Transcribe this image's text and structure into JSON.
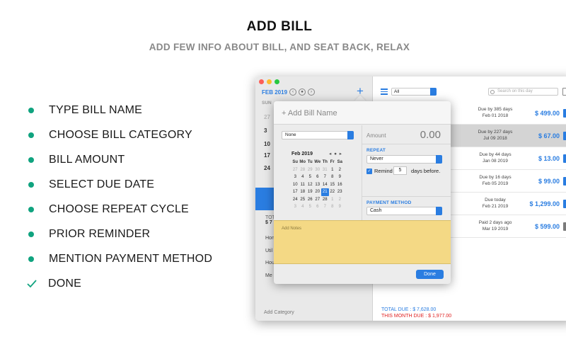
{
  "hero": {
    "title": "ADD BILL",
    "subtitle": "ADD FEW INFO ABOUT BILL, AND SEAT BACK, RELAX"
  },
  "features": [
    {
      "label": "TYPE BILL NAME",
      "marker": "dot"
    },
    {
      "label": "CHOOSE BILL CATEGORY",
      "marker": "dot"
    },
    {
      "label": "BILL AMOUNT",
      "marker": "dot"
    },
    {
      "label": "SELECT DUE DATE",
      "marker": "dot"
    },
    {
      "label": "CHOOSE REPEAT CYCLE",
      "marker": "dot"
    },
    {
      "label": "PRIOR REMINDER",
      "marker": "dot"
    },
    {
      "label": "MENTION PAYMENT METHOD",
      "marker": "dot"
    },
    {
      "label": "DONE",
      "marker": "check"
    }
  ],
  "colors": {
    "accent": "#10a37f",
    "blue": "#2a7de1",
    "notes": "#f4d985",
    "red": "#e02020"
  },
  "sidebar": {
    "month": "FEB 2019",
    "week_label": "SUN",
    "dates": [
      "27",
      "3",
      "10",
      "17",
      "24"
    ],
    "total_label": "TOT",
    "total_amount": "$ 7",
    "categories": [
      "Hon",
      "Util",
      "Hou",
      "Me"
    ],
    "add_category": "Add Category"
  },
  "main": {
    "filter": "All",
    "search_placeholder": "Search on this day",
    "bills": [
      {
        "due_line1": "Due by 385 days",
        "due_line2": "Feb 01 2018",
        "amount": "$ 499.00",
        "selected": false,
        "paid": false
      },
      {
        "due_line1": "Due by 227 days",
        "due_line2": "Jul 09 2018",
        "amount": "$ 67.00",
        "selected": true,
        "paid": false
      },
      {
        "due_line1": "Due by 44 days",
        "due_line2": "Jan 08 2019",
        "amount": "$ 13.00",
        "selected": false,
        "paid": false
      },
      {
        "due_line1": "Due by 16 days",
        "due_line2": "Feb 05 2019",
        "amount": "$ 99.00",
        "selected": false,
        "paid": false
      },
      {
        "due_line1": "Due today",
        "due_line2": "Feb 21 2019",
        "amount": "$ 1,299.00",
        "selected": false,
        "paid": false
      },
      {
        "due_line1": "Paid 2 days ago",
        "due_line2": "Mar 19 2019",
        "amount": "$ 599.00",
        "selected": false,
        "paid": true
      }
    ],
    "total_due": "TOTAL DUE : $ 7,628.00",
    "month_due": "THIS MONTH DUE : $ 1,977.00"
  },
  "popover": {
    "name_placeholder": "+ Add Bill Name",
    "category": "None",
    "amount_label": "Amount",
    "amount_value": "0.00",
    "calendar": {
      "header": "Feb 2019",
      "nav": "◂ ● ▸",
      "weekdays": [
        "Su",
        "Mo",
        "Tu",
        "We",
        "Th",
        "Fr",
        "Sa"
      ],
      "days": [
        {
          "d": "27",
          "dim": true
        },
        {
          "d": "28",
          "dim": true
        },
        {
          "d": "29",
          "dim": true
        },
        {
          "d": "30",
          "dim": true
        },
        {
          "d": "31",
          "dim": true
        },
        {
          "d": "1"
        },
        {
          "d": "2"
        },
        {
          "d": "3"
        },
        {
          "d": "4"
        },
        {
          "d": "5"
        },
        {
          "d": "6"
        },
        {
          "d": "7"
        },
        {
          "d": "8"
        },
        {
          "d": "9"
        },
        {
          "d": "10"
        },
        {
          "d": "11"
        },
        {
          "d": "12"
        },
        {
          "d": "13"
        },
        {
          "d": "14"
        },
        {
          "d": "15"
        },
        {
          "d": "16"
        },
        {
          "d": "17"
        },
        {
          "d": "18"
        },
        {
          "d": "19"
        },
        {
          "d": "20"
        },
        {
          "d": "21",
          "today": true
        },
        {
          "d": "22"
        },
        {
          "d": "23"
        },
        {
          "d": "24"
        },
        {
          "d": "25"
        },
        {
          "d": "26"
        },
        {
          "d": "27"
        },
        {
          "d": "28"
        },
        {
          "d": "1",
          "dim": true
        },
        {
          "d": "2",
          "dim": true
        },
        {
          "d": "3",
          "dim": true
        },
        {
          "d": "4",
          "dim": true
        },
        {
          "d": "5",
          "dim": true
        },
        {
          "d": "6",
          "dim": true
        },
        {
          "d": "7",
          "dim": true
        },
        {
          "d": "8",
          "dim": true
        },
        {
          "d": "9",
          "dim": true
        }
      ]
    },
    "repeat_label": "REPEAT",
    "repeat_value": "Never",
    "remind_label": "Remind",
    "remind_days": "5",
    "remind_suffix": "days before.",
    "payment_label": "PAYMENT METHOD",
    "payment_value": "Cash",
    "notes_placeholder": "Add Notes",
    "done_label": "Done"
  }
}
